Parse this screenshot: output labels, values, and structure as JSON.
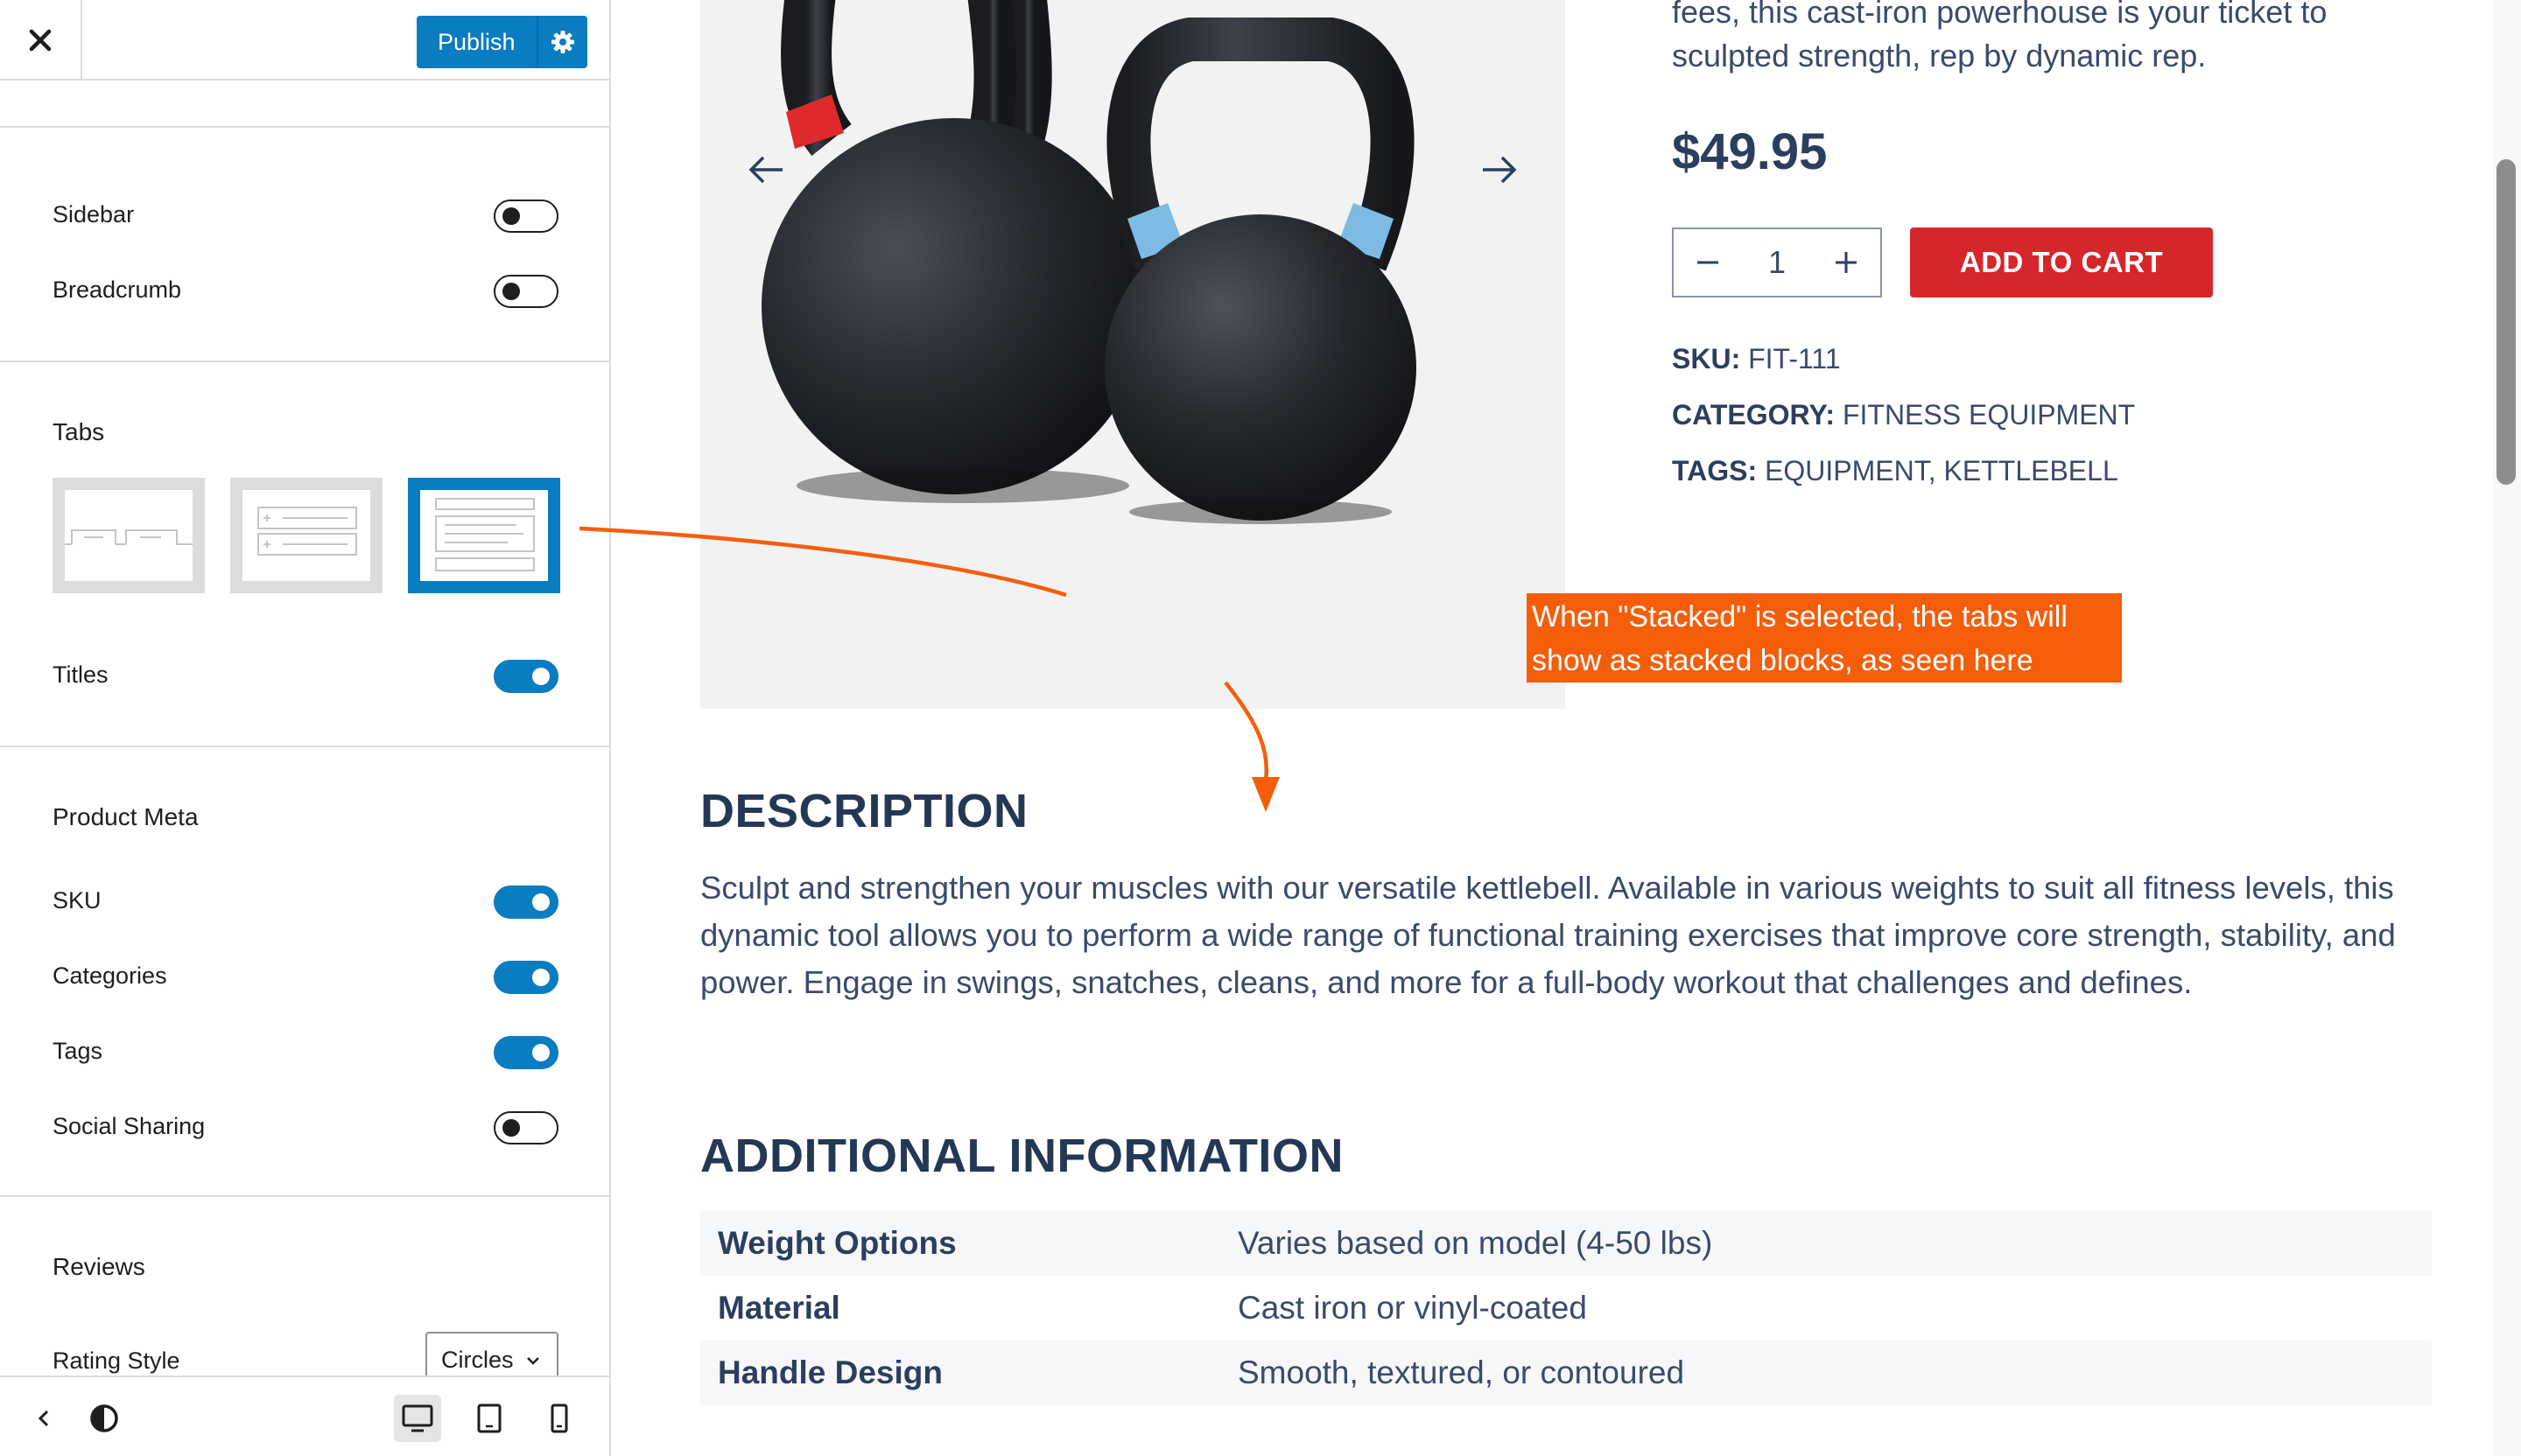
{
  "topbar": {
    "publish_label": "Publish"
  },
  "sidebar": {
    "toggles": [
      {
        "label": "Sidebar",
        "on": false
      },
      {
        "label": "Breadcrumb",
        "on": false
      }
    ],
    "tabs_title": "Tabs",
    "tab_layouts": [
      "tabs-horizontal",
      "tabs-accordion",
      "tabs-stacked"
    ],
    "tab_layout_selected": "tabs-stacked",
    "titles": {
      "label": "Titles",
      "on": true
    },
    "product_meta": {
      "title": "Product Meta",
      "items": [
        {
          "label": "SKU",
          "on": true
        },
        {
          "label": "Categories",
          "on": true
        },
        {
          "label": "Tags",
          "on": true
        },
        {
          "label": "Social Sharing",
          "on": false
        }
      ]
    },
    "reviews": {
      "title": "Reviews",
      "rating_style_label": "Rating Style",
      "rating_style_value": "Circles"
    }
  },
  "bottombar": {
    "icons": [
      "back-arrow-icon",
      "contrast-icon",
      "desktop-icon",
      "tablet-icon",
      "mobile-icon"
    ],
    "active_device": "desktop"
  },
  "product": {
    "short_desc_lines": [
      "fees, this cast-iron powerhouse is your ticket to",
      "sculpted strength, rep by dynamic rep."
    ],
    "price": "$49.95",
    "quantity": "1",
    "add_to_cart": "ADD TO CART",
    "sku_label": "SKU:",
    "sku_value": "FIT-111",
    "category_label": "CATEGORY:",
    "category_value": "FITNESS EQUIPMENT",
    "tags_label": "TAGS:",
    "tags_values": "EQUIPMENT, KETTLEBELL"
  },
  "description": {
    "heading": "DESCRIPTION",
    "text": "Sculpt and strengthen your muscles with our versatile kettlebell. Available in various weights to suit all fitness levels, this dynamic tool allows you to perform a wide range of functional training exercises that improve core strength, stability, and power. Engage in swings, snatches, cleans, and more for a full-body workout that challenges and defines."
  },
  "additional_info": {
    "heading": "ADDITIONAL INFORMATION",
    "rows": [
      {
        "attr": "Weight Options",
        "value": "Varies based on model (4-50 lbs)"
      },
      {
        "attr": "Material",
        "value": "Cast iron or vinyl-coated"
      },
      {
        "attr": "Handle Design",
        "value": "Smooth, textured, or contoured"
      }
    ]
  },
  "annotation": {
    "lines": [
      "When \"Stacked\" is selected, the tabs will",
      "show as stacked blocks, as seen here"
    ],
    "color": "#f45e0b"
  },
  "colors": {
    "accent": "#0a7cc1",
    "cart_button": "#d7262b",
    "heading": "#243755",
    "body_text": "#3b4a6b"
  }
}
